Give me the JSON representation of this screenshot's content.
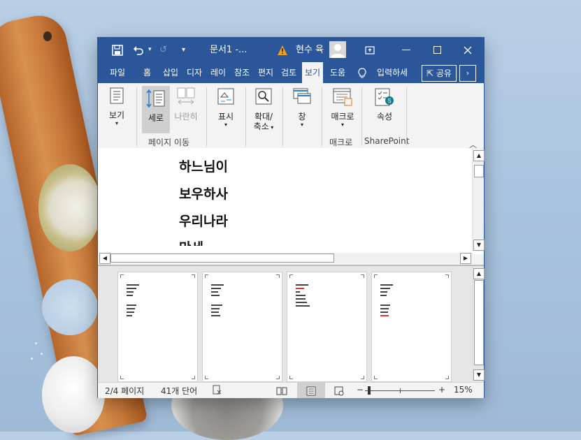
{
  "window": {
    "doc_title": "문서1  -...",
    "user_name": "현수 육"
  },
  "tabs": [
    "파일",
    "홈",
    "삽입",
    "디자",
    "레이",
    "참조",
    "편지",
    "검토",
    "보기",
    "도움"
  ],
  "tell_me": "입력하세",
  "share_label": "공유",
  "ribbon": {
    "view_label": "보기",
    "vertical_label": "세로",
    "side_by_side_label": "나란히",
    "group_page_move": "페이지 이동",
    "show_label": "표시",
    "zoom_label_1": "확대/",
    "zoom_label_2": "축소",
    "window_label": "창",
    "macro_label": "매크로",
    "group_macro": "매크로",
    "properties_label": "속성",
    "group_sharepoint": "SharePoint"
  },
  "document": {
    "lines": [
      "하느님이",
      "보우하사",
      "우리나라",
      "만세"
    ]
  },
  "status": {
    "page": "2/4 페이지",
    "words": "41개 단어",
    "zoom_minus": "−",
    "zoom_plus": "+",
    "zoom_percent": "15%",
    "zoom_level": 15
  },
  "icons": {
    "save": "save-icon",
    "undo": "undo-icon",
    "redo": "redo-icon",
    "warning": "warning-icon",
    "close": "close-icon"
  },
  "colors": {
    "titlebar": "#2b579a",
    "warning": "#f0a020"
  }
}
